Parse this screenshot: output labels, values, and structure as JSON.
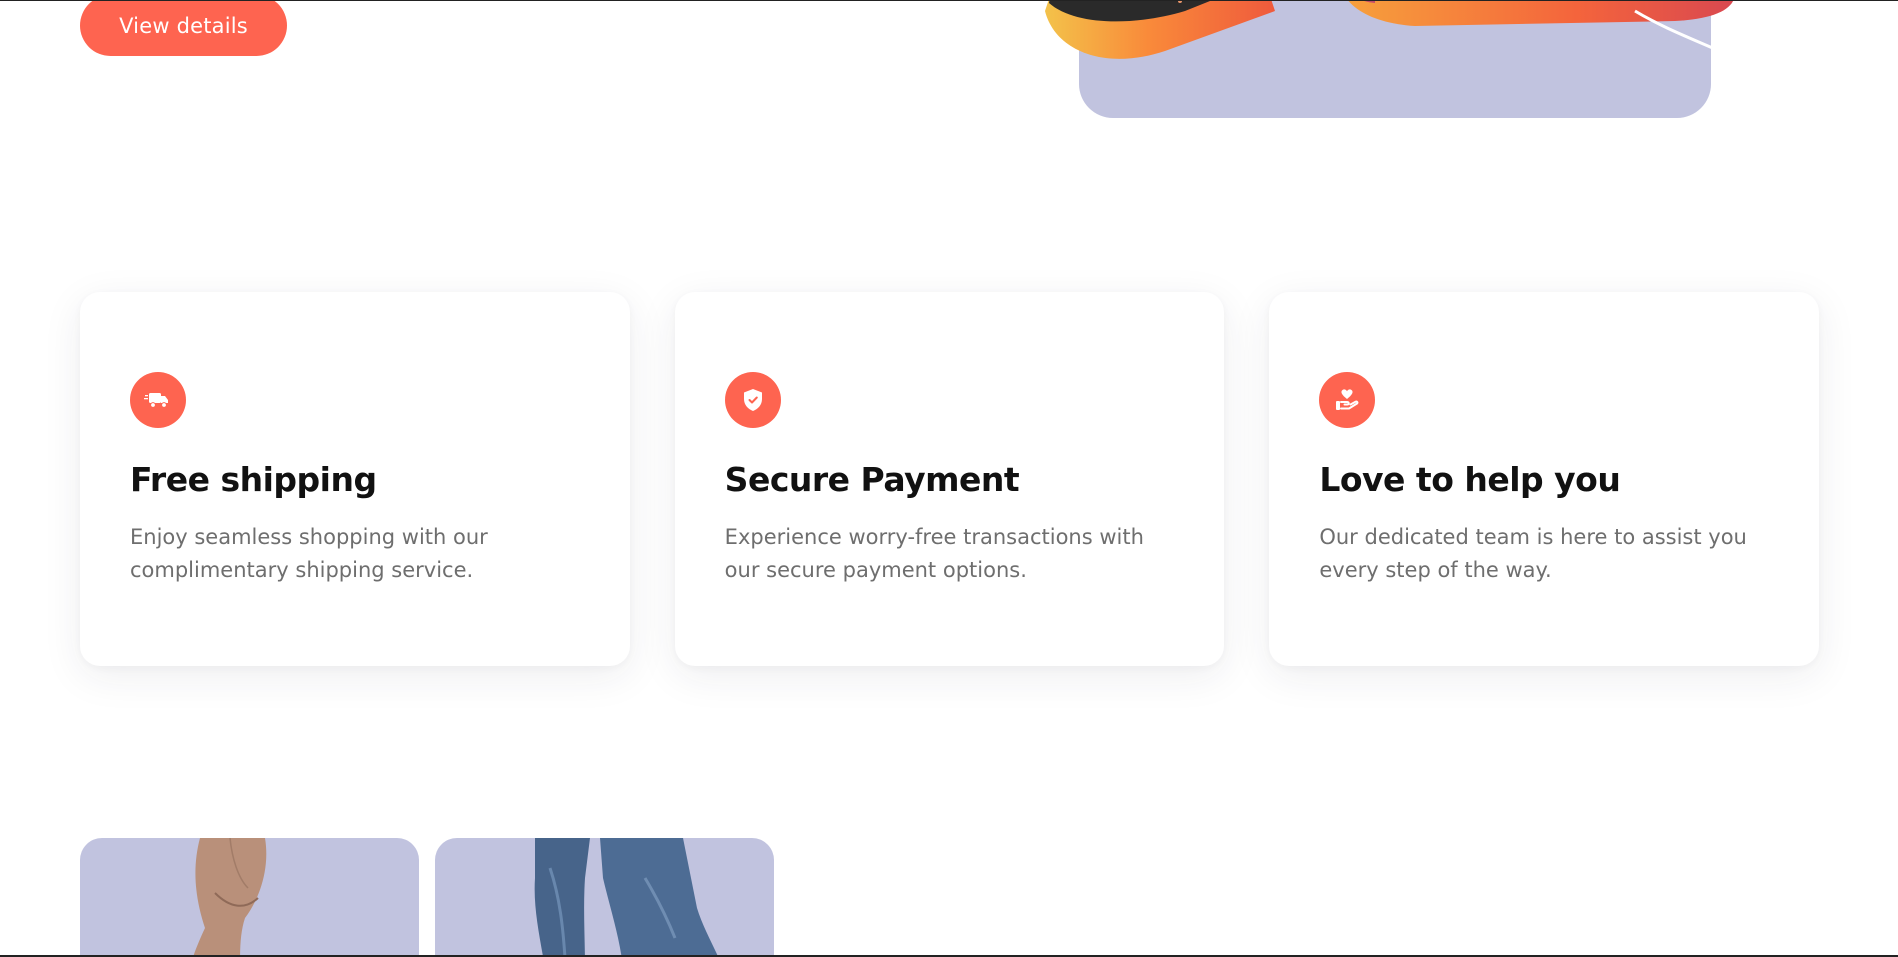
{
  "hero": {
    "view_details_label": "View details"
  },
  "features": [
    {
      "icon": "truck-icon",
      "title": "Free shipping",
      "description": "Enjoy seamless shopping with our complimentary shipping service."
    },
    {
      "icon": "shield-check-icon",
      "title": "Secure Payment",
      "description": "Experience worry-free transactions with our secure payment options."
    },
    {
      "icon": "heart-hand-icon",
      "title": "Love to help you",
      "description": "Our dedicated team is here to assist you every step of the way."
    }
  ],
  "colors": {
    "accent": "#fe6450",
    "image_background": "#c1c3df",
    "title_text": "#111111",
    "body_text": "#6e6e6e"
  }
}
